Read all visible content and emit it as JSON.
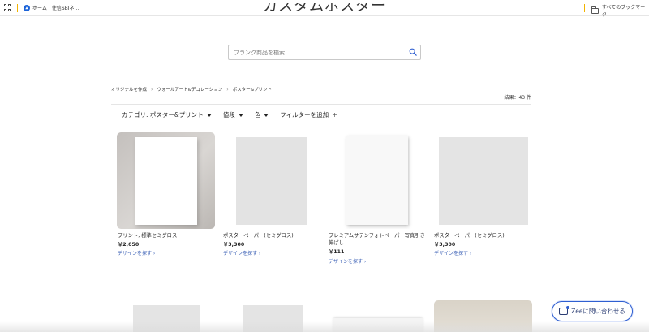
{
  "bookmarks_bar": {
    "item_label": "ホーム｜住信SBIネ...",
    "favicon_glyph": "",
    "all_bookmarks_label": "すべてのブックマーク"
  },
  "page": {
    "title": "カスタムポスター",
    "search_placeholder": "ブランク商品を検索"
  },
  "breadcrumb": [
    "オリジナルを作成",
    "ウォールアート&デコレーション",
    "ポスター&プリント"
  ],
  "result_count": "結果：43 件",
  "filters": {
    "category": "カテゴリ: ポスター&プリント",
    "price": "値段",
    "color": "色",
    "add_filter": "フィルターを追加"
  },
  "products": [
    {
      "title": "プリント, 標準セミグロス",
      "price": "￥2,050",
      "link": "デザインを探す ›"
    },
    {
      "title": "ポスターペーパー(セミグロス)",
      "price": "￥3,300",
      "link": "デザインを探す ›"
    },
    {
      "title": "プレミアムサテンフォトペーパー写真引き伸ばし",
      "price": "￥111",
      "link": "デザインを探す ›"
    },
    {
      "title": "ポスターペーパー(セミグロス)",
      "price": "￥3,300",
      "link": "デザインを探す ›"
    }
  ],
  "chat_button": {
    "label": "Zeeに問い合わせる"
  },
  "colors": {
    "link": "#3a5fb5",
    "chat_border": "#2f5fd1",
    "bookmark_divider": "#f2b300"
  }
}
